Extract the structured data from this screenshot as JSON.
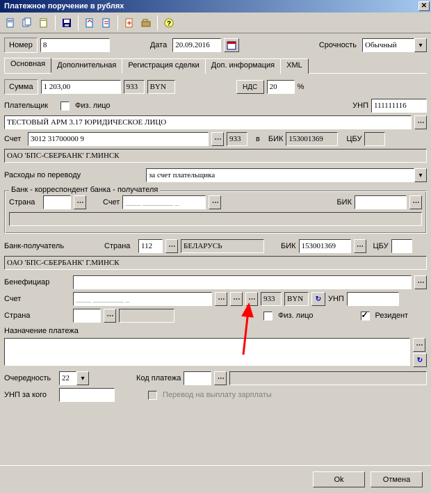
{
  "window": {
    "title": "Платежное поручение в рублях"
  },
  "header": {
    "number_label": "Номер",
    "number_value": "8",
    "date_label": "Дата",
    "date_value": "20.09.2016",
    "urgency_label": "Срочность",
    "urgency_value": "Обычный"
  },
  "tabs": [
    "Основная",
    "Дополнительная",
    "Регистрация сделки",
    "Доп. информация",
    "XML"
  ],
  "sum": {
    "label": "Сумма",
    "amount": "1 203,00",
    "code": "933",
    "currency": "BYN",
    "vat_label": "НДС",
    "vat_value": "20",
    "percent": "%"
  },
  "payer": {
    "label": "Плательщик",
    "fiz_label": "Физ. лицо",
    "unp_label": "УНП",
    "unp_value": "111111116",
    "name": "ТЕСТОВЫЙ АРМ 3.17 ЮРИДИЧЕСКОЕ ЛИЦО",
    "account_label": "Счет",
    "account_value": "3012 31700000 9",
    "account_code": "933",
    "v_label": "в",
    "bik_label": "БИК",
    "bik_value": "153001369",
    "cbu_label": "ЦБУ",
    "bank_name": "ОАО 'БПС-СБЕРБАНК' Г.МИНСК"
  },
  "transfer_costs": {
    "label": "Расходы по переводу",
    "value": "за счет плательщика"
  },
  "corr_bank": {
    "title": "Банк - корреспондент банка - получателя",
    "country_label": "Страна",
    "account_label": "Счет",
    "account_mask": "____ ________ _",
    "bik_label": "БИК"
  },
  "recv_bank": {
    "label": "Банк-получатель",
    "country_label": "Страна",
    "country_code": "112",
    "country_name": "БЕЛАРУСЬ",
    "bik_label": "БИК",
    "bik_value": "153001369",
    "cbu_label": "ЦБУ",
    "bank_name": "ОАО 'БПС-СБЕРБАНК' Г.МИНСК"
  },
  "beneficiary": {
    "label": "Бенефициар",
    "account_label": "Счет",
    "account_mask": "____ ________ _",
    "code": "933",
    "currency": "BYN",
    "unp_label": "УНП",
    "country_label": "Страна",
    "fiz_label": "Физ. лицо",
    "resident_label": "Резидент"
  },
  "purpose": {
    "label": "Назначение платежа"
  },
  "footer_form": {
    "priority_label": "Очередность",
    "priority_value": "22",
    "payment_code_label": "Код платежа",
    "unp_for_label": "УНП за кого",
    "salary_transfer_label": "Перевод на выплату зарплаты"
  },
  "buttons": {
    "ok": "Ok",
    "cancel": "Отмена"
  }
}
